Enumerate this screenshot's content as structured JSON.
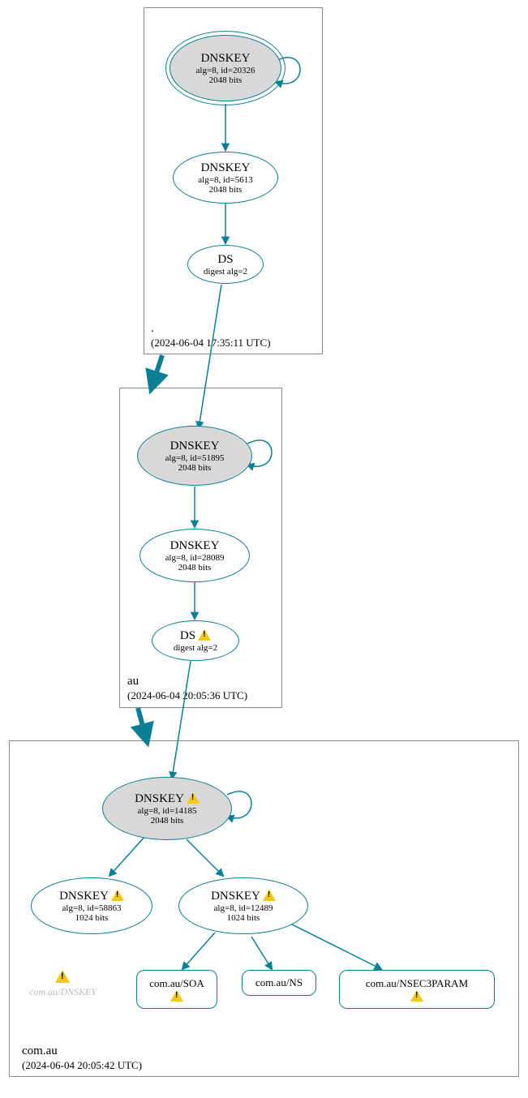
{
  "zones": {
    "root": {
      "name": ".",
      "timestamp": "(2024-06-04 17:35:11 UTC)"
    },
    "au": {
      "name": "au",
      "timestamp": "(2024-06-04 20:05:36 UTC)"
    },
    "comau": {
      "name": "com.au",
      "timestamp": "(2024-06-04 20:05:42 UTC)"
    }
  },
  "nodes": {
    "root_ksk": {
      "title": "DNSKEY",
      "sub1": "alg=8, id=20326",
      "sub2": "2048 bits"
    },
    "root_zsk": {
      "title": "DNSKEY",
      "sub1": "alg=8, id=5613",
      "sub2": "2048 bits"
    },
    "root_ds": {
      "title": "DS",
      "sub1": "digest alg=2"
    },
    "au_ksk": {
      "title": "DNSKEY",
      "sub1": "alg=8, id=51895",
      "sub2": "2048 bits"
    },
    "au_zsk": {
      "title": "DNSKEY",
      "sub1": "alg=8, id=28089",
      "sub2": "2048 bits"
    },
    "au_ds": {
      "title": "DS",
      "sub1": "digest alg=2"
    },
    "comau_ksk": {
      "title": "DNSKEY",
      "sub1": "alg=8, id=14185",
      "sub2": "2048 bits"
    },
    "comau_zsk1": {
      "title": "DNSKEY",
      "sub1": "alg=8, id=58863",
      "sub2": "1024 bits"
    },
    "comau_zsk2": {
      "title": "DNSKEY",
      "sub1": "alg=8, id=12489",
      "sub2": "1024 bits"
    },
    "rr_soa": {
      "title": "com.au/SOA"
    },
    "rr_ns": {
      "title": "com.au/NS"
    },
    "rr_nsec3": {
      "title": "com.au/NSEC3PARAM"
    },
    "faint": {
      "label": "com.au/DNSKEY"
    }
  },
  "colors": {
    "stroke": "#0a7f95"
  }
}
